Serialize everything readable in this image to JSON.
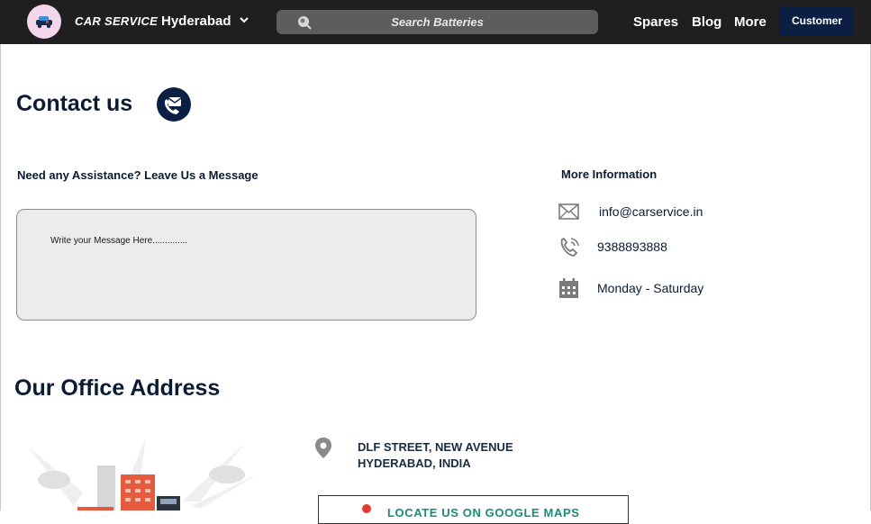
{
  "header": {
    "brand": "CAR SERVICE",
    "city": "Hyderabad",
    "search_placeholder": "Search Batteries",
    "nav": [
      "Spares",
      "Blog",
      "More"
    ],
    "customer_button": "Customer"
  },
  "contact": {
    "title": "Contact us",
    "assistance_heading": "Need any Assistance? Leave Us a Message",
    "message_placeholder": "Write your Message Here..............",
    "more_info_heading": "More Information",
    "email": "info@carservice.in",
    "phone": "9388893888",
    "hours": "Monday - Saturday"
  },
  "office": {
    "title": "Our Office Address",
    "address_line1": "DLF STREET, NEW AVENUE",
    "address_line2": "HYDERABAD, INDIA",
    "locate_button": "LOCATE US ON GOOGLE MAPS"
  },
  "icons": {
    "logo": "car-logo-icon",
    "city_dropdown": "chevron-down-icon",
    "search": "search-icon",
    "contact": "phone-envelope-icon",
    "email": "envelope-icon",
    "phone": "phone-icon",
    "hours": "calendar-icon",
    "address": "map-pin-icon"
  },
  "colors": {
    "header_bg": "#1f1f1f",
    "accent_navy": "#0b1f45",
    "message_box_bg": "#ececec",
    "locate_text": "#1a8c7a"
  }
}
